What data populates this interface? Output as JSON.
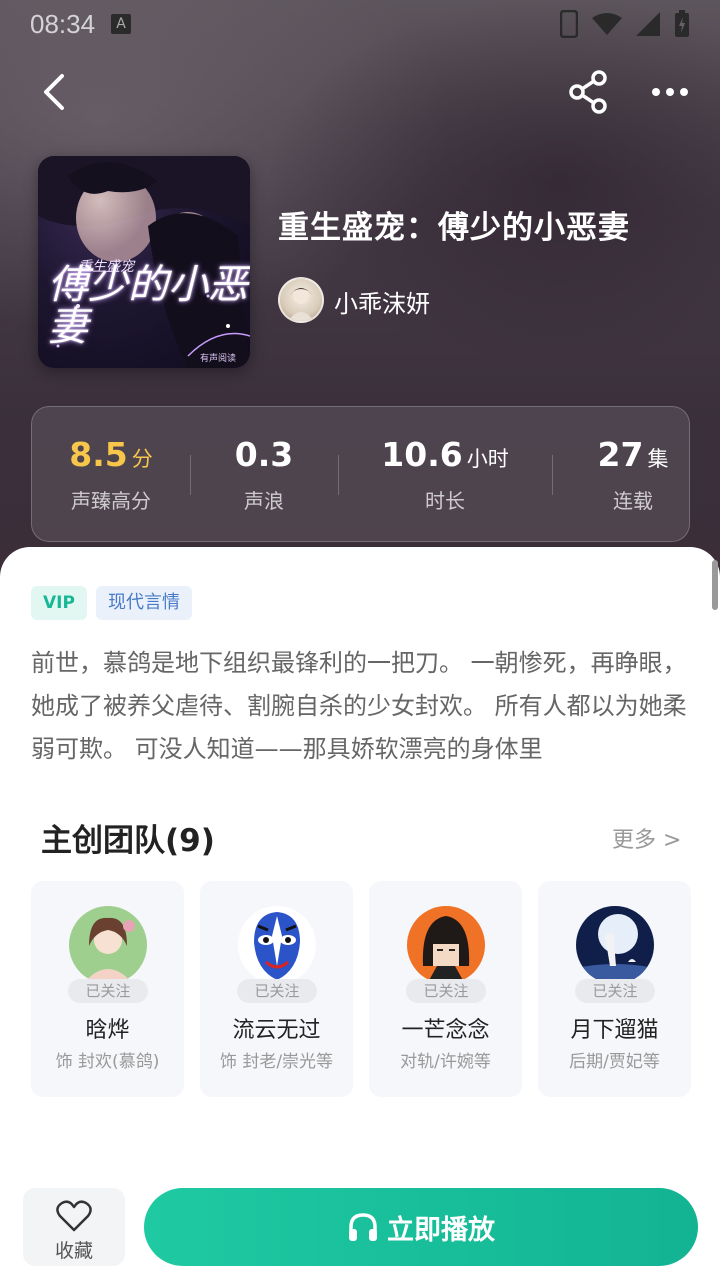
{
  "status_bar": {
    "time": "08:34",
    "notification_letter": "A"
  },
  "header": {
    "back_icon": "chevron-left-icon",
    "share_icon": "share-icon",
    "more_icon": "more-dots-icon"
  },
  "book": {
    "cover_title": "傅少的小恶妻",
    "cover_subtitle": "重生盛宠",
    "cover_credit": "有声阅读",
    "title": "重生盛宠：傅少的小恶妻",
    "author": "小乖沫妍"
  },
  "stats": [
    {
      "value": "8.5",
      "unit": "分",
      "label": "声臻高分",
      "color": "#f7c64a"
    },
    {
      "value": "0.3",
      "unit": "",
      "label": "声浪",
      "color": "#ffffff"
    },
    {
      "value": "10.6",
      "unit": "小时",
      "label": "时长",
      "color": "#ffffff"
    },
    {
      "value": "27",
      "unit": "集",
      "label": "连载",
      "color": "#ffffff"
    }
  ],
  "tags": {
    "vip": "VIP",
    "genre": "现代言情"
  },
  "synopsis": "前世，慕鸽是地下组织最锋利的一把刀。 一朝惨死，再睁眼，她成了被养父虐待、割腕自杀的少女封欢。 所有人都以为她柔弱可欺。 可没人知道——那具娇软漂亮的身体里",
  "team": {
    "title": "主创团队(9)",
    "more": "更多 >",
    "members": [
      {
        "name": "晗烨",
        "role": "饰 封欢(慕鸽)",
        "badge": "已关注"
      },
      {
        "name": "流云无过",
        "role": "饰 封老/崇光等",
        "badge": "已关注"
      },
      {
        "name": "一芒念念",
        "role": "对轨/许婉等",
        "badge": "已关注"
      },
      {
        "name": "月下遛猫",
        "role": "后期/贾妃等",
        "badge": "已关注"
      }
    ]
  },
  "bottom_bar": {
    "favorite_label": "收藏",
    "play_label": "立即播放"
  },
  "colors": {
    "accent": "#1fcaa2",
    "score": "#f7c64a"
  }
}
